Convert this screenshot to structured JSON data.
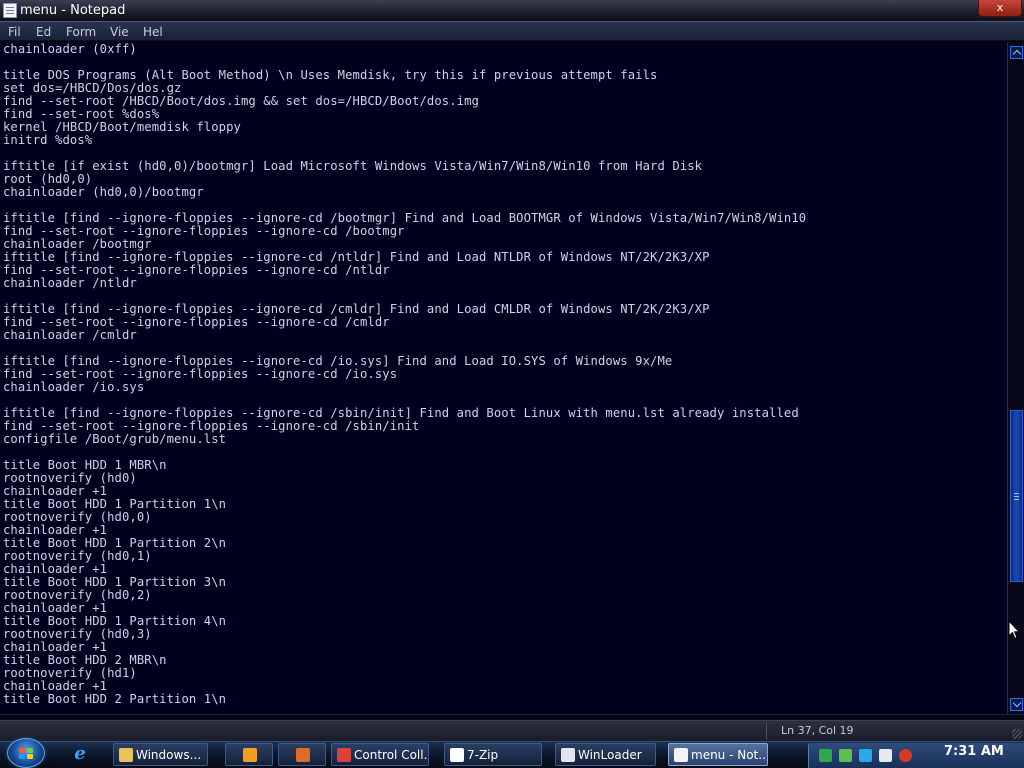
{
  "window": {
    "title": "menu - Notepad",
    "close_label": "x"
  },
  "menu": [
    {
      "label": "Fil"
    },
    {
      "label": "Ed"
    },
    {
      "label": "Form"
    },
    {
      "label": "Vie"
    },
    {
      "label": "Hel"
    }
  ],
  "editor": {
    "lines": [
      "chainloader (0xff)",
      "",
      "title DOS Programs (Alt Boot Method) \\n Uses Memdisk, try this if previous attempt fails",
      "set dos=/HBCD/Dos/dos.gz",
      "find --set-root /HBCD/Boot/dos.img && set dos=/HBCD/Boot/dos.img",
      "find --set-root %dos%",
      "kernel /HBCD/Boot/memdisk floppy",
      "initrd %dos%",
      "",
      "iftitle [if exist (hd0,0)/bootmgr] Load Microsoft Windows Vista/Win7/Win8/Win10 from Hard Disk",
      "root (hd0,0)",
      "chainloader (hd0,0)/bootmgr",
      "",
      "iftitle [find --ignore-floppies --ignore-cd /bootmgr] Find and Load BOOTMGR of Windows Vista/Win7/Win8/Win10",
      "find --set-root --ignore-floppies --ignore-cd /bootmgr",
      "chainloader /bootmgr",
      "iftitle [find --ignore-floppies --ignore-cd /ntldr] Find and Load NTLDR of Windows NT/2K/2K3/XP",
      "find --set-root --ignore-floppies --ignore-cd /ntldr",
      "chainloader /ntldr",
      "",
      "iftitle [find --ignore-floppies --ignore-cd /cmldr] Find and Load CMLDR of Windows NT/2K/2K3/XP",
      "find --set-root --ignore-floppies --ignore-cd /cmldr",
      "chainloader /cmldr",
      "",
      "iftitle [find --ignore-floppies --ignore-cd /io.sys] Find and Load IO.SYS of Windows 9x/Me",
      "find --set-root --ignore-floppies --ignore-cd /io.sys",
      "chainloader /io.sys",
      "",
      "iftitle [find --ignore-floppies --ignore-cd /sbin/init] Find and Boot Linux with menu.lst already installed",
      "find --set-root --ignore-floppies --ignore-cd /sbin/init",
      "configfile /Boot/grub/menu.lst",
      "",
      "title Boot HDD 1 MBR\\n",
      "rootnoverify (hd0)",
      "chainloader +1",
      "title Boot HDD 1 Partition 1\\n",
      "rootnoverify (hd0,0)",
      "chainloader +1",
      "title Boot HDD 1 Partition 2\\n",
      "rootnoverify (hd0,1)",
      "chainloader +1",
      "title Boot HDD 1 Partition 3\\n",
      "rootnoverify (hd0,2)",
      "chainloader +1",
      "title Boot HDD 1 Partition 4\\n",
      "rootnoverify (hd0,3)",
      "chainloader +1",
      "title Boot HDD 2 MBR\\n",
      "rootnoverify (hd1)",
      "chainloader +1",
      "title Boot HDD 2 Partition 1\\n"
    ]
  },
  "scrollbar": {
    "thumb_start_fraction": 0.55,
    "thumb_end_fraction": 0.82
  },
  "status": {
    "position": "Ln 37, Col 19"
  },
  "taskbar": {
    "buttons": [
      {
        "label": "Windows...",
        "icon": "folder-icon",
        "color": "#e8c25a"
      },
      {
        "label": "",
        "icon": "media-player-icon",
        "color": "#f0a020"
      },
      {
        "label": "",
        "icon": "paint-icon",
        "color": "#e06a2a"
      },
      {
        "label": "Control Coll...",
        "icon": "chrome-icon",
        "color": "#d9423a"
      },
      {
        "label": "7-Zip",
        "icon": "7zip-icon",
        "color": "#ffffff"
      },
      {
        "label": "WinLoader",
        "icon": "window-icon",
        "color": "#dfe6f2"
      },
      {
        "label": "menu - Not...",
        "icon": "notepad-icon",
        "color": "#f4f4f4"
      }
    ],
    "clock": "7:31 AM"
  }
}
